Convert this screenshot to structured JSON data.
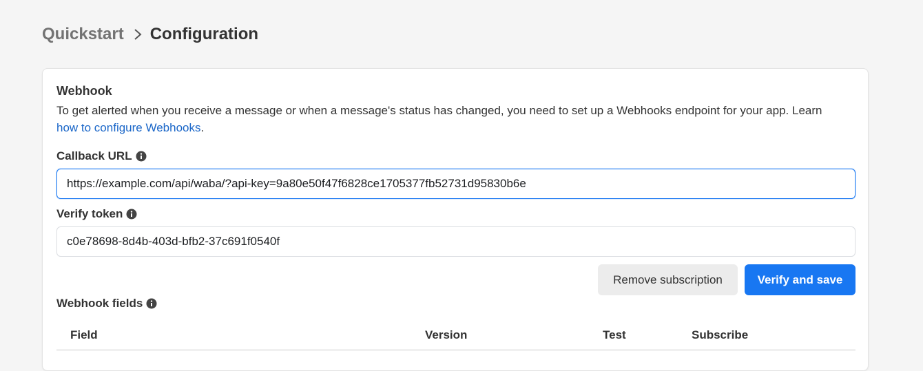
{
  "breadcrumb": {
    "parent": "Quickstart",
    "current": "Configuration"
  },
  "webhook": {
    "title": "Webhook",
    "description": "To get alerted when you receive a message or when a message's status has changed, you need to set up a Webhooks endpoint for your app. Learn",
    "link_text": "how to configure Webhooks",
    "link_suffix": ".",
    "callback_url": {
      "label": "Callback URL",
      "value": "https://example.com/api/waba/?api-key=9a80e50f47f6828ce1705377fb52731d95830b6e"
    },
    "verify_token": {
      "label": "Verify token",
      "value": "c0e78698-8d4b-403d-bfb2-37c691f0540f"
    },
    "buttons": {
      "remove": "Remove subscription",
      "verify": "Verify and save"
    },
    "fields": {
      "label": "Webhook fields",
      "columns": [
        "Field",
        "Version",
        "Test",
        "Subscribe"
      ]
    }
  },
  "colors": {
    "primary": "#1877f2",
    "link": "#1a66c8"
  },
  "icons": {
    "breadcrumb_separator": "chevron-right-icon",
    "info": "info-icon"
  }
}
